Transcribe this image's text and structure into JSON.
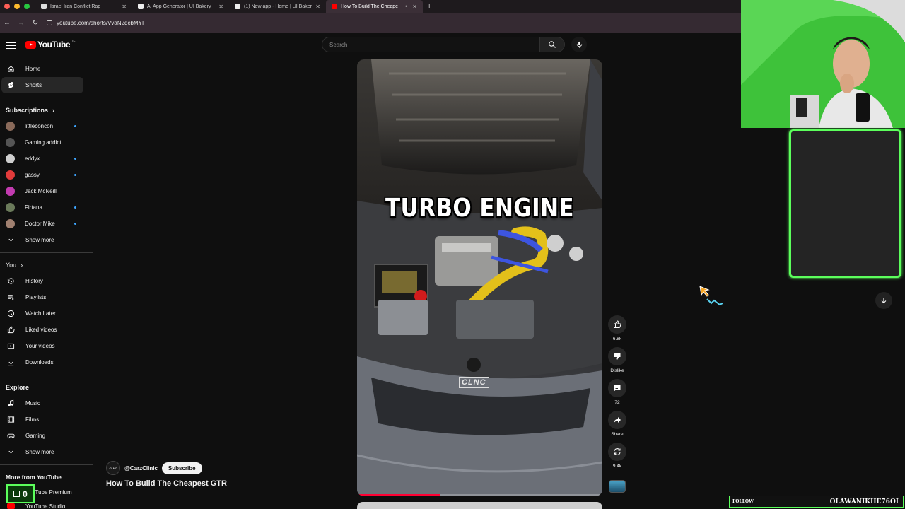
{
  "browser": {
    "tabs": [
      {
        "title": "Israel Iran Conflict Rap",
        "active": false
      },
      {
        "title": "AI App Generator | UI Bakery",
        "active": false
      },
      {
        "title": "(1) New app - Home | UI Bakery",
        "active": false
      },
      {
        "title": "How To Build The Cheape",
        "active": true
      }
    ],
    "url": "youtube.com/shorts/VvaN2dcbMYI"
  },
  "masthead": {
    "logo_text": "YouTube",
    "country_code": "IE",
    "search_placeholder": "Search"
  },
  "sidebar": {
    "main": [
      {
        "label": "Home",
        "icon": "home-icon"
      },
      {
        "label": "Shorts",
        "icon": "shorts-icon",
        "active": true
      }
    ],
    "subscriptions_title": "Subscriptions",
    "subscriptions": [
      {
        "label": "littleconcon",
        "color": "#8a6a5a",
        "new": true
      },
      {
        "label": "Gaming addict",
        "color": "#555555",
        "new": false
      },
      {
        "label": "eddyx",
        "color": "#cfcfcf",
        "new": true
      },
      {
        "label": "gassy",
        "color": "#e23b3b",
        "new": true
      },
      {
        "label": "Jack McNeill",
        "color": "#c23bb0",
        "new": false
      },
      {
        "label": "Firtana",
        "color": "#6a7a5a",
        "new": true
      },
      {
        "label": "Doctor Mike",
        "color": "#a08070",
        "new": true
      }
    ],
    "show_more_1": "Show more",
    "you_title": "You",
    "you": [
      {
        "label": "History",
        "icon": "history-icon"
      },
      {
        "label": "Playlists",
        "icon": "playlists-icon"
      },
      {
        "label": "Watch Later",
        "icon": "watch-later-icon"
      },
      {
        "label": "Liked videos",
        "icon": "like-icon"
      },
      {
        "label": "Your videos",
        "icon": "your-videos-icon"
      },
      {
        "label": "Downloads",
        "icon": "download-icon"
      }
    ],
    "explore_title": "Explore",
    "explore": [
      {
        "label": "Music",
        "icon": "music-icon"
      },
      {
        "label": "Films",
        "icon": "films-icon"
      },
      {
        "label": "Gaming",
        "icon": "gaming-icon"
      }
    ],
    "show_more_2": "Show more",
    "more_title": "More from YouTube",
    "more": [
      {
        "label": "YouTube Premium"
      },
      {
        "label": "YouTube Studio"
      }
    ]
  },
  "short": {
    "overlay_text": "TURBO ENGINE",
    "watermark": "CLNC",
    "progress": 0.34,
    "channel_handle": "@CarzClinic",
    "channel_avatar_text": "CLNC",
    "subscribe_label": "Subscribe",
    "title": "How To Build The Cheapest GTR"
  },
  "actions": {
    "likes": "6.8k",
    "dislike": "Dislike",
    "comments": "72",
    "share": "Share",
    "remix": "9.4k"
  },
  "stream_overlay": {
    "follow_label": "FOLLOW",
    "streamer_name": "OLAWANIKHE76OI",
    "counter_value": "0",
    "accent_color": "#5cff5c"
  }
}
